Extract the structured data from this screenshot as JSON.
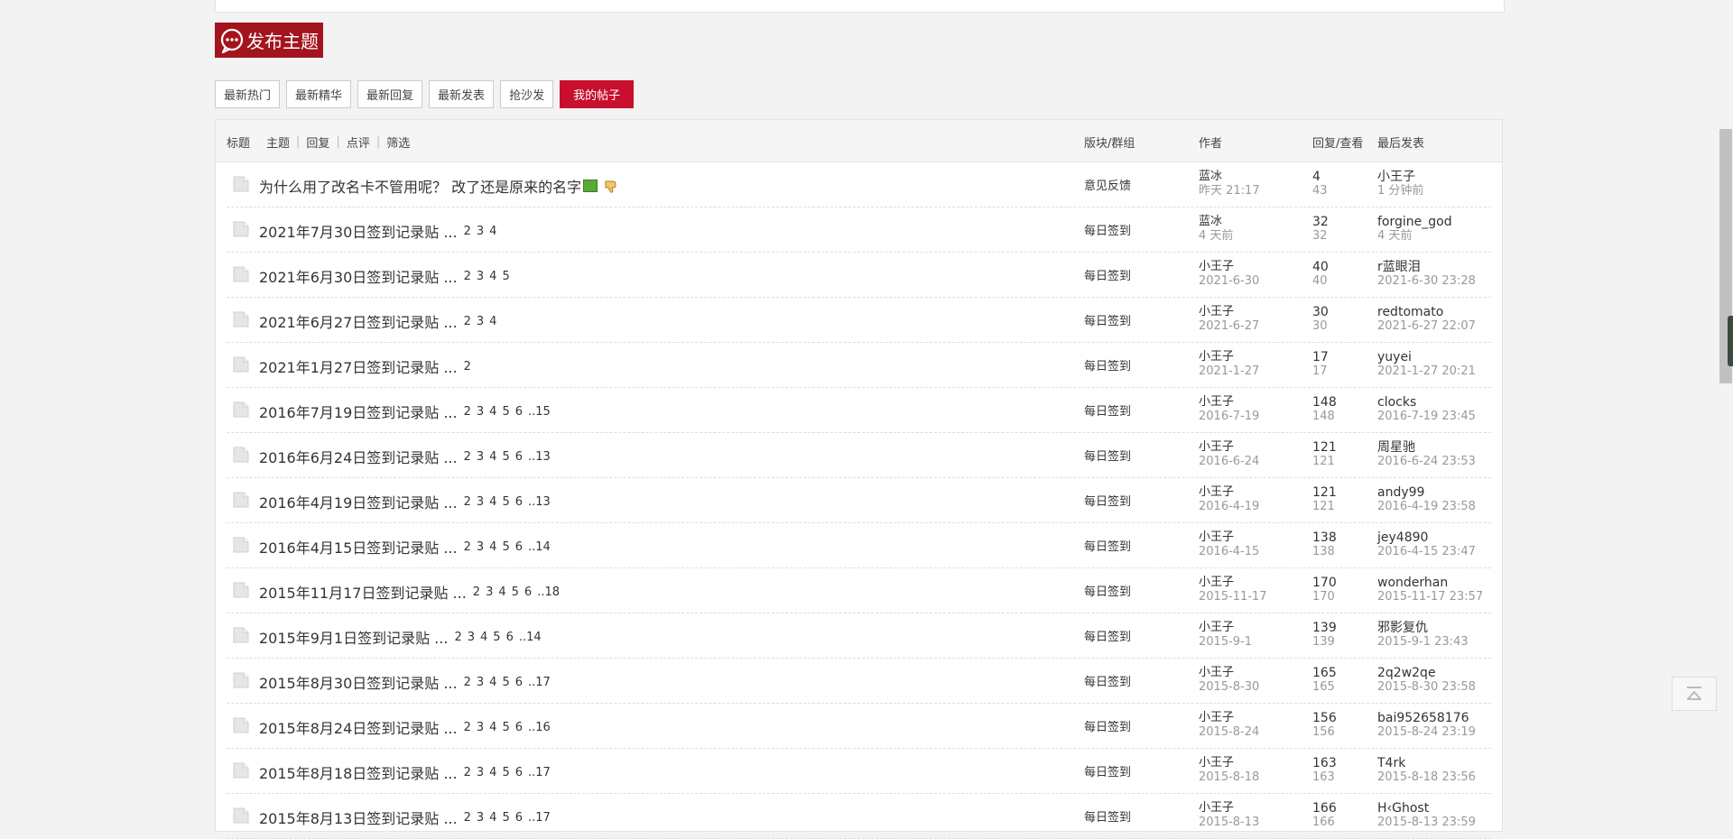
{
  "post_button": {
    "label": "发布主题"
  },
  "filters": [
    "最新热门",
    "最新精华",
    "最新回复",
    "最新发表",
    "抢沙发"
  ],
  "active_filter": "我的帖子",
  "header": {
    "title": "标题",
    "tabs": [
      "主题",
      "回复",
      "点评",
      "筛选"
    ],
    "forum": "版块/群组",
    "author": "作者",
    "stats": "回复/查看",
    "last": "最后发表"
  },
  "threads": [
    {
      "title": "为什么用了改名卡不管用呢？ 改了还是原来的名字",
      "pages": [],
      "forum": "意见反馈",
      "author": "蓝冰",
      "date": "昨天 21:17",
      "replies": "4",
      "views": "43",
      "last_user": "小王子",
      "last_time": "1 分钟前",
      "has_image": true,
      "has_hand": true
    },
    {
      "title": "2021年7月30日签到记录贴 ...",
      "pages": [
        "2",
        "3",
        "4"
      ],
      "forum": "每日签到",
      "author": "蓝冰",
      "date": "4 天前",
      "replies": "32",
      "views": "32",
      "last_user": "forgine_god",
      "last_time": "4 天前"
    },
    {
      "title": "2021年6月30日签到记录贴 ...",
      "pages": [
        "2",
        "3",
        "4",
        "5"
      ],
      "forum": "每日签到",
      "author": "小王子",
      "date": "2021-6-30",
      "replies": "40",
      "views": "40",
      "last_user": "r蓝眼泪",
      "last_time": "2021-6-30 23:28"
    },
    {
      "title": "2021年6月27日签到记录贴 ...",
      "pages": [
        "2",
        "3",
        "4"
      ],
      "forum": "每日签到",
      "author": "小王子",
      "date": "2021-6-27",
      "replies": "30",
      "views": "30",
      "last_user": "redtomato",
      "last_time": "2021-6-27 22:07"
    },
    {
      "title": "2021年1月27日签到记录贴 ...",
      "pages": [
        "2"
      ],
      "forum": "每日签到",
      "author": "小王子",
      "date": "2021-1-27",
      "replies": "17",
      "views": "17",
      "last_user": "yuyei",
      "last_time": "2021-1-27 20:21"
    },
    {
      "title": "2016年7月19日签到记录贴 ...",
      "pages": [
        "2",
        "3",
        "4",
        "5",
        "6",
        "..15"
      ],
      "forum": "每日签到",
      "author": "小王子",
      "date": "2016-7-19",
      "replies": "148",
      "views": "148",
      "last_user": "clocks",
      "last_time": "2016-7-19 23:45"
    },
    {
      "title": "2016年6月24日签到记录贴 ...",
      "pages": [
        "2",
        "3",
        "4",
        "5",
        "6",
        "..13"
      ],
      "forum": "每日签到",
      "author": "小王子",
      "date": "2016-6-24",
      "replies": "121",
      "views": "121",
      "last_user": "周星驰",
      "last_time": "2016-6-24 23:53"
    },
    {
      "title": "2016年4月19日签到记录贴 ...",
      "pages": [
        "2",
        "3",
        "4",
        "5",
        "6",
        "..13"
      ],
      "forum": "每日签到",
      "author": "小王子",
      "date": "2016-4-19",
      "replies": "121",
      "views": "121",
      "last_user": "andy99",
      "last_time": "2016-4-19 23:58"
    },
    {
      "title": "2016年4月15日签到记录贴 ...",
      "pages": [
        "2",
        "3",
        "4",
        "5",
        "6",
        "..14"
      ],
      "forum": "每日签到",
      "author": "小王子",
      "date": "2016-4-15",
      "replies": "138",
      "views": "138",
      "last_user": "jey4890",
      "last_time": "2016-4-15 23:47"
    },
    {
      "title": "2015年11月17日签到记录贴 ...",
      "pages": [
        "2",
        "3",
        "4",
        "5",
        "6",
        "..18"
      ],
      "forum": "每日签到",
      "author": "小王子",
      "date": "2015-11-17",
      "replies": "170",
      "views": "170",
      "last_user": "wonderhan",
      "last_time": "2015-11-17 23:57"
    },
    {
      "title": "2015年9月1日签到记录贴 ...",
      "pages": [
        "2",
        "3",
        "4",
        "5",
        "6",
        "..14"
      ],
      "forum": "每日签到",
      "author": "小王子",
      "date": "2015-9-1",
      "replies": "139",
      "views": "139",
      "last_user": "邪影复仇",
      "last_time": "2015-9-1 23:43"
    },
    {
      "title": "2015年8月30日签到记录贴 ...",
      "pages": [
        "2",
        "3",
        "4",
        "5",
        "6",
        "..17"
      ],
      "forum": "每日签到",
      "author": "小王子",
      "date": "2015-8-30",
      "replies": "165",
      "views": "165",
      "last_user": "2q2w2qe",
      "last_time": "2015-8-30 23:58"
    },
    {
      "title": "2015年8月24日签到记录贴 ...",
      "pages": [
        "2",
        "3",
        "4",
        "5",
        "6",
        "..16"
      ],
      "forum": "每日签到",
      "author": "小王子",
      "date": "2015-8-24",
      "replies": "156",
      "views": "156",
      "last_user": "bai952658176",
      "last_time": "2015-8-24 23:19"
    },
    {
      "title": "2015年8月18日签到记录贴 ...",
      "pages": [
        "2",
        "3",
        "4",
        "5",
        "6",
        "..17"
      ],
      "forum": "每日签到",
      "author": "小王子",
      "date": "2015-8-18",
      "replies": "163",
      "views": "163",
      "last_user": "T4rk",
      "last_time": "2015-8-18 23:56"
    },
    {
      "title": "2015年8月13日签到记录贴 ...",
      "pages": [
        "2",
        "3",
        "4",
        "5",
        "6",
        "..17"
      ],
      "forum": "每日签到",
      "author": "小王子",
      "date": "2015-8-13",
      "replies": "166",
      "views": "166",
      "last_user": "H‹Ghost",
      "last_time": "2015-8-13 23:59"
    }
  ]
}
